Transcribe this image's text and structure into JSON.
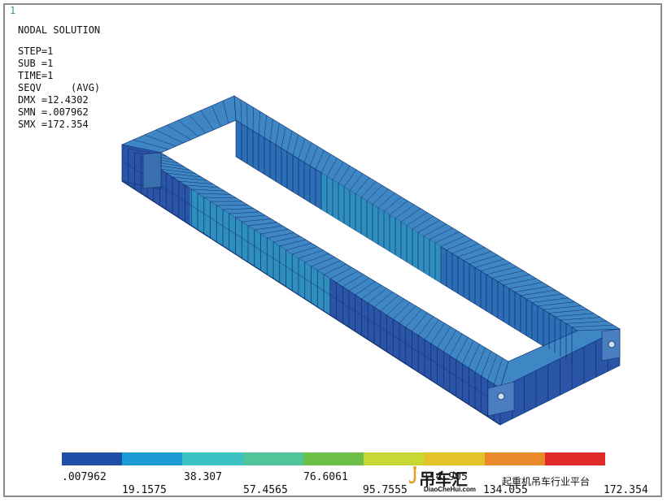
{
  "window_number": "1",
  "header": {
    "title": "NODAL SOLUTION",
    "step": "STEP=1",
    "sub": "SUB =1",
    "time": "TIME=1",
    "seqv": "SEQV     (AVG)",
    "dmx": "DMX =12.4302",
    "smn": "SMN =.007962",
    "smx": "SMX =172.354"
  },
  "legend": {
    "colors": [
      "#1e4ea6",
      "#1c9bd6",
      "#3cc1c4",
      "#4fc59a",
      "#6cc04a",
      "#c6d834",
      "#e5c22a",
      "#e8892a",
      "#e02a2a"
    ],
    "top_labels": [
      ".007962",
      "38.307",
      "76.6061",
      "114.905"
    ],
    "bottom_labels": [
      "19.1575",
      "57.4565",
      "95.7555",
      "134.055",
      "172.354"
    ]
  },
  "watermark": {
    "logo": "吊车汇",
    "site": "DiaoCheHui.com",
    "tagline": "起重机吊车行业平台"
  },
  "model_colors": {
    "outer_face": "#2a54a8",
    "inner_face": "#2c6fb6",
    "top_face": "#3e86c4",
    "mid_stress": "#2e8fbf",
    "grid_line": "#12306a"
  }
}
